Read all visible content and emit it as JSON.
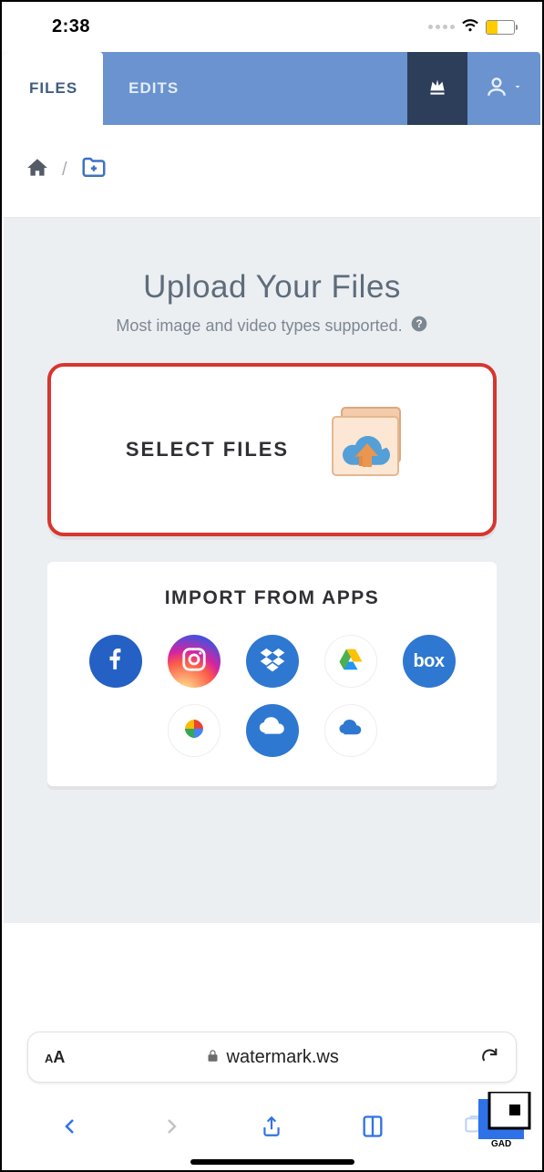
{
  "status": {
    "time": "2:38"
  },
  "header": {
    "tabs": [
      {
        "label": "FILES",
        "active": true
      },
      {
        "label": "EDITS",
        "active": false
      }
    ]
  },
  "upload": {
    "title": "Upload Your Files",
    "subtitle": "Most image and video types supported.",
    "select_label": "SELECT FILES"
  },
  "import": {
    "title": "IMPORT FROM APPS",
    "apps_row1": [
      "facebook",
      "instagram",
      "dropbox",
      "google-drive",
      "box"
    ],
    "apps_row2": [
      "google-photos",
      "onedrive",
      "onedrive-personal"
    ],
    "box_label": "box"
  },
  "browser": {
    "url_display": "watermark.ws"
  }
}
